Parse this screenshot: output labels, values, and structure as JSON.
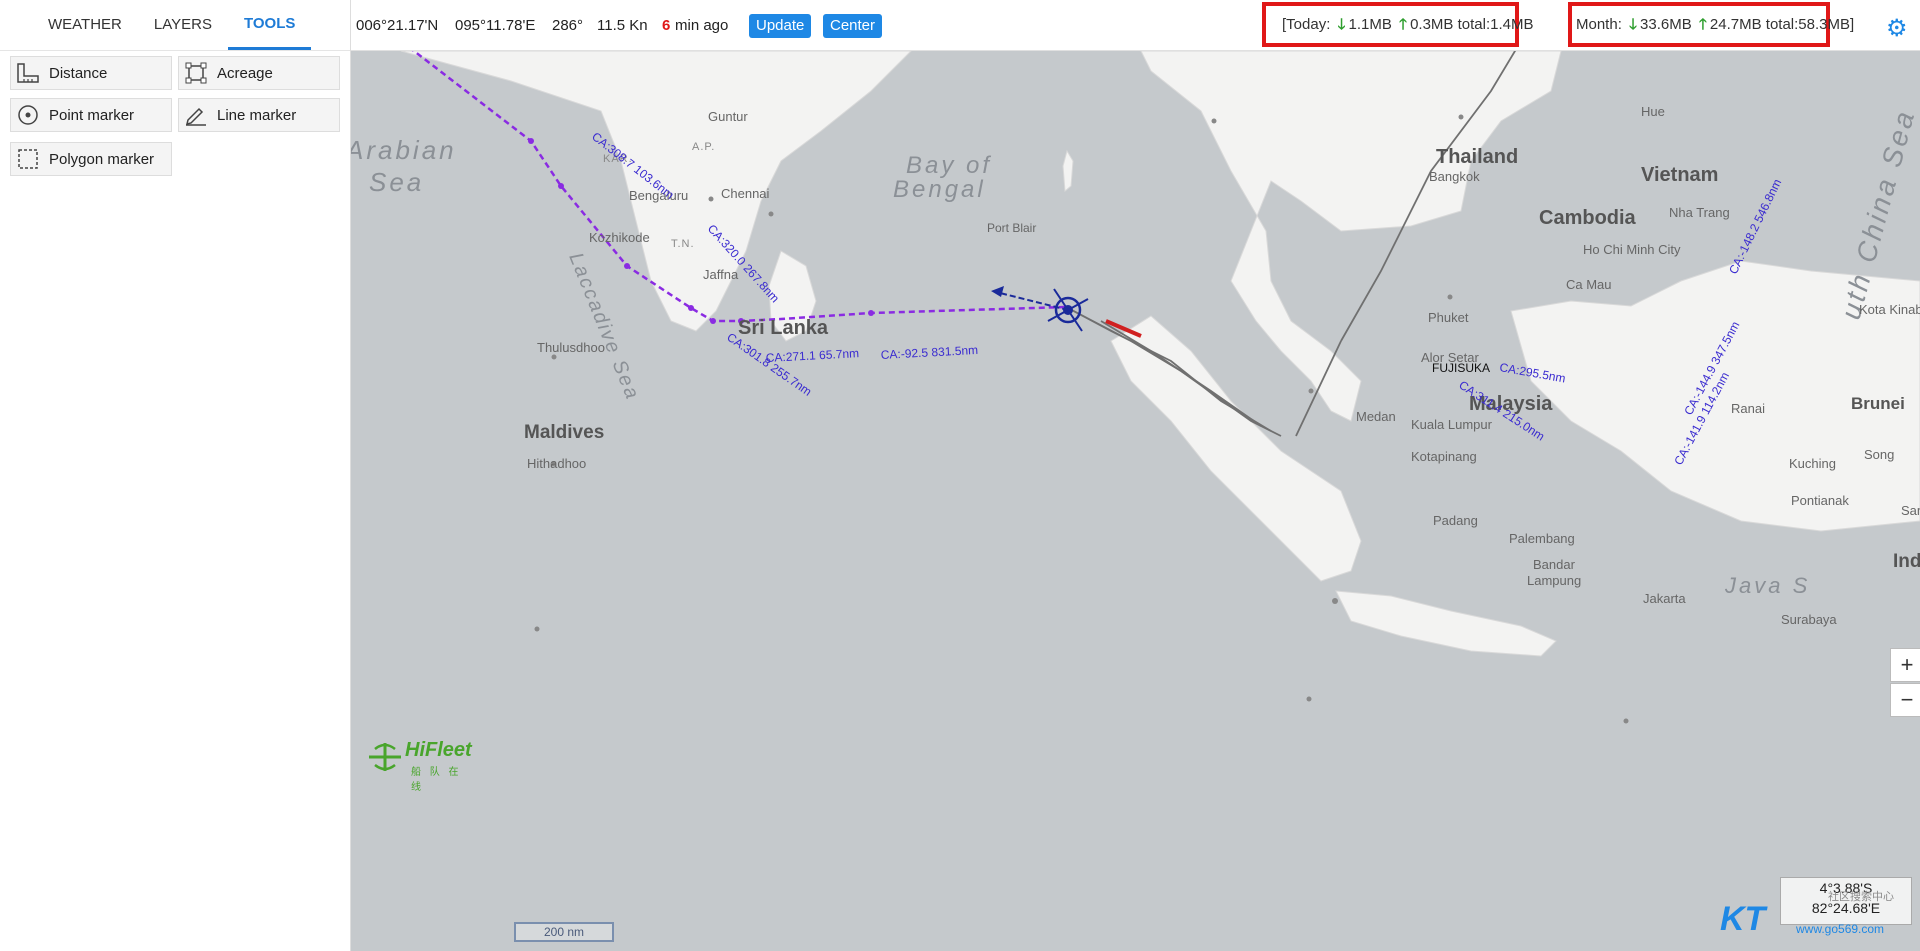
{
  "tabs": [
    {
      "label": "WEATHER",
      "active": false
    },
    {
      "label": "LAYERS",
      "active": false
    },
    {
      "label": "TOOLS",
      "active": true
    }
  ],
  "tools": {
    "distance": "Distance",
    "acreage": "Acreage",
    "point_marker": "Point marker",
    "line_marker": "Line marker",
    "polygon_marker": "Polygon marker"
  },
  "topbar": {
    "lat": "006°21.17'N",
    "lon": "095°11.78'E",
    "heading": "286°",
    "speed": "11.5 Kn",
    "age_value": "6",
    "age_unit": "min ago",
    "update_label": "Update",
    "center_label": "Center"
  },
  "usage": {
    "today_prefix": "[Today:",
    "today_down": "1.1MB",
    "today_up": "0.3MB",
    "today_total": "total:1.4MB",
    "month_prefix": "Month:",
    "month_down": "33.6MB",
    "month_up": "24.7MB",
    "month_total": "total:58.3MB]"
  },
  "map": {
    "labels": [
      {
        "text": "Arabian",
        "cls": "sea"
      },
      {
        "text": "Sea",
        "cls": "sea"
      },
      {
        "text": "Bay of",
        "cls": "sea"
      },
      {
        "text": "Bengal",
        "cls": "sea"
      },
      {
        "text": "Laccadive Sea",
        "cls": "sea"
      },
      {
        "text": "Java S",
        "cls": "sea"
      },
      {
        "text": "uth China Sea",
        "cls": "sea"
      },
      {
        "text": "Thailand",
        "cls": "country"
      },
      {
        "text": "Vietnam",
        "cls": "country"
      },
      {
        "text": "Cambodia",
        "cls": "country"
      },
      {
        "text": "Malaysia",
        "cls": "country"
      },
      {
        "text": "Sri Lanka",
        "cls": "country"
      },
      {
        "text": "Maldives",
        "cls": "country"
      },
      {
        "text": "Brunei",
        "cls": "country"
      },
      {
        "text": "Ind",
        "cls": "country"
      },
      {
        "text": "Guntur",
        "cls": "city"
      },
      {
        "text": "KAR.",
        "cls": "region"
      },
      {
        "text": "A.P.",
        "cls": "region"
      },
      {
        "text": "T.N.",
        "cls": "region"
      },
      {
        "text": "Bengaluru",
        "cls": "city"
      },
      {
        "text": "Chennai",
        "cls": "city"
      },
      {
        "text": "Kozhikode",
        "cls": "city"
      },
      {
        "text": "Jaffna",
        "cls": "city"
      },
      {
        "text": "Thulusdhoo",
        "cls": "city"
      },
      {
        "text": "Hithadhoo",
        "cls": "city"
      },
      {
        "text": "Port Blair",
        "cls": "city"
      },
      {
        "text": "Bangkok",
        "cls": "city"
      },
      {
        "text": "Hue",
        "cls": "city"
      },
      {
        "text": "Nha Trang",
        "cls": "city"
      },
      {
        "text": "Ho Chi Minh City",
        "cls": "city"
      },
      {
        "text": "Ca Mau",
        "cls": "city"
      },
      {
        "text": "Phuket",
        "cls": "city"
      },
      {
        "text": "Alor Setar",
        "cls": "city"
      },
      {
        "text": "Kuala Lumpur",
        "cls": "city"
      },
      {
        "text": "Medan",
        "cls": "city"
      },
      {
        "text": "Kotapinang",
        "cls": "city"
      },
      {
        "text": "Padang",
        "cls": "city"
      },
      {
        "text": "Palembang",
        "cls": "city"
      },
      {
        "text": "Bandar",
        "cls": "city"
      },
      {
        "text": "Lampung",
        "cls": "city"
      },
      {
        "text": "Jakarta",
        "cls": "city"
      },
      {
        "text": "Surabaya",
        "cls": "city"
      },
      {
        "text": "Pontianak",
        "cls": "city"
      },
      {
        "text": "Kuching",
        "cls": "city"
      },
      {
        "text": "Song",
        "cls": "city"
      },
      {
        "text": "Ranai",
        "cls": "city"
      },
      {
        "text": "Kota Kinab",
        "cls": "city"
      },
      {
        "text": "Sam",
        "cls": "city"
      }
    ],
    "route_labels": [
      "CA:308.7  103.6nm",
      "CA:320.0  267.8nm",
      "CA:301.8  255.7nm",
      "CA:271.1  65.7nm",
      "CA:-92.5  831.5nm",
      "CA:-148.2  546.8nm",
      "CA:-144.9  347.5nm",
      "CA:-141.9  114.2nm",
      "CA:311.4  215.0nm",
      "CA:295.5nm"
    ],
    "ship_name": "FUJISUKA",
    "scale_label": "200 nm",
    "cursor_lat": "4°3.88'S",
    "cursor_lon": "82°24.68'E",
    "logo_name": "HiFleet",
    "logo_sub": "船 队 在 线",
    "watermark_text": "www.go569.com",
    "watermark_sub": "社区搜索中心"
  },
  "zoom": {
    "in": "+",
    "out": "−"
  },
  "colors": {
    "accent": "#1e88e5",
    "route": "#8a2be2",
    "alert_border": "#e01818",
    "age_red": "#e01818"
  }
}
